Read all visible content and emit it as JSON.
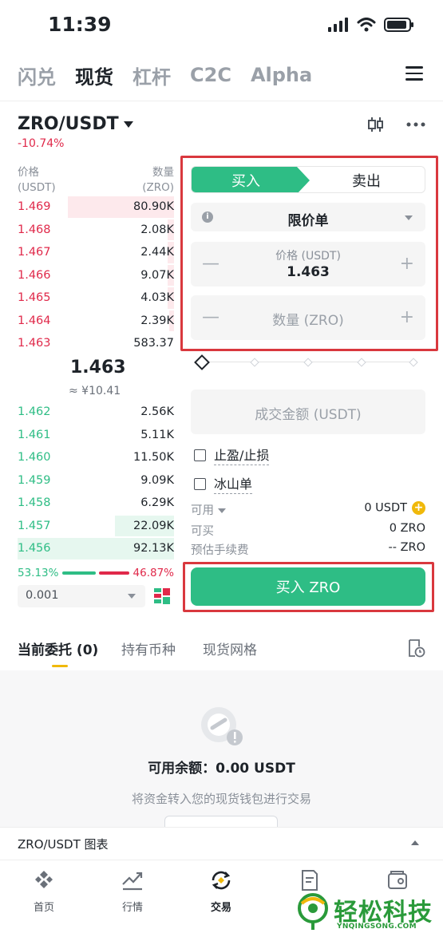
{
  "status": {
    "time": "11:39"
  },
  "top_tabs": [
    "闪兑",
    "现货",
    "杠杆",
    "C2C",
    "Alpha"
  ],
  "pair": {
    "name": "ZRO/USDT",
    "change": "-10.74%"
  },
  "orderbook": {
    "price_label": "价格",
    "price_unit": "(USDT)",
    "qty_label": "数量",
    "qty_unit": "(ZRO)",
    "asks": [
      {
        "price": "1.469",
        "qty": "80.90K",
        "depth": 0.68
      },
      {
        "price": "1.468",
        "qty": "2.08K",
        "depth": 0.04
      },
      {
        "price": "1.467",
        "qty": "2.44K",
        "depth": 0.04
      },
      {
        "price": "1.466",
        "qty": "9.07K",
        "depth": 0.04
      },
      {
        "price": "1.465",
        "qty": "4.03K",
        "depth": 0.04
      },
      {
        "price": "1.464",
        "qty": "2.39K",
        "depth": 0.03
      },
      {
        "price": "1.463",
        "qty": "583.37",
        "depth": 0.0
      }
    ],
    "mid_price": "1.463",
    "mid_cny": "≈ ¥10.41",
    "bids": [
      {
        "price": "1.462",
        "qty": "2.56K",
        "depth": 0.0
      },
      {
        "price": "1.461",
        "qty": "5.11K",
        "depth": 0.0
      },
      {
        "price": "1.460",
        "qty": "11.50K",
        "depth": 0.0
      },
      {
        "price": "1.459",
        "qty": "9.09K",
        "depth": 0.0
      },
      {
        "price": "1.458",
        "qty": "6.29K",
        "depth": 0.0
      },
      {
        "price": "1.457",
        "qty": "22.09K",
        "depth": 0.38
      },
      {
        "price": "1.456",
        "qty": "92.13K",
        "depth": 1.0
      }
    ],
    "buy_ratio": "53.13%",
    "sell_ratio": "46.87%",
    "precision": "0.001"
  },
  "form": {
    "buy_label": "买入",
    "sell_label": "卖出",
    "order_type": "限价单",
    "price_label": "价格 (USDT)",
    "price_value": "1.463",
    "qty_placeholder": "数量 (ZRO)",
    "total_placeholder": "成交金额 (USDT)",
    "tpsl_label": "止盈/止损",
    "iceberg_label": "冰山单",
    "available_label": "可用",
    "available_value": "0 USDT",
    "can_buy_label": "可买",
    "can_buy_value": "0 ZRO",
    "fee_label": "预估手续费",
    "fee_value": "-- ZRO",
    "submit_label": "买入 ZRO"
  },
  "orders": {
    "tab_open": "当前委托",
    "tab_open_count": "(0)",
    "tab_holdings": "持有币种",
    "tab_grid": "现货网格",
    "balance": "可用余额：0.00 USDT",
    "tip": "将资金转入您的现货钱包进行交易"
  },
  "chart_bar": {
    "label": "ZRO/USDT 图表"
  },
  "nav": [
    {
      "label": "首页",
      "icon": "home-icon"
    },
    {
      "label": "行情",
      "icon": "markets-icon"
    },
    {
      "label": "交易",
      "icon": "trade-icon"
    },
    {
      "label": "",
      "icon": "futures-icon"
    },
    {
      "label": "",
      "icon": "wallet-icon"
    }
  ],
  "watermark": {
    "text": "轻松科技",
    "sub": "YNQINGSONG.COM"
  },
  "colors": {
    "green": "#2ebd85",
    "red": "#e0294a",
    "yellow": "#f0b90b",
    "highlight": "#d9383e"
  }
}
